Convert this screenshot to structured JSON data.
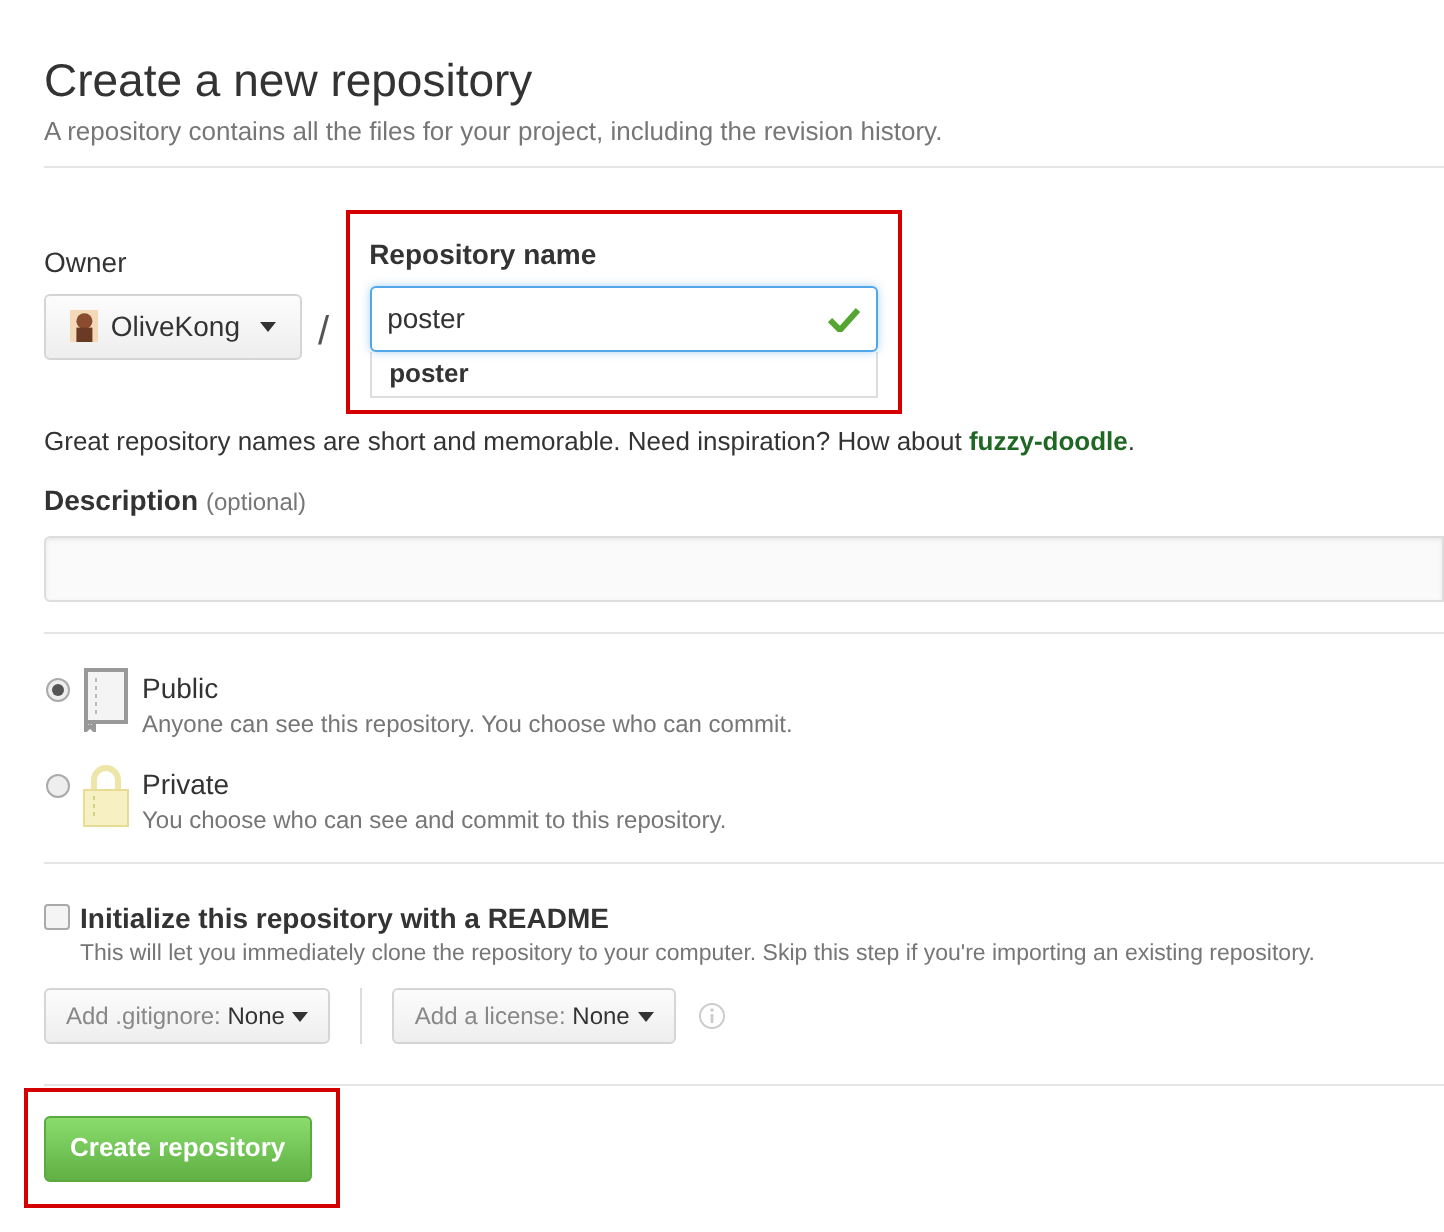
{
  "header": {
    "title": "Create a new repository",
    "subtitle": "A repository contains all the files for your project, including the revision history."
  },
  "owner": {
    "label": "Owner",
    "value": "OliveKong"
  },
  "separator": "/",
  "repository_name": {
    "label": "Repository name",
    "value": "poster",
    "valid": true,
    "highlighted": true,
    "suggestions": [
      "poster"
    ]
  },
  "hint": {
    "text": "Great repository names are short and memorable. Need inspiration? How about ",
    "link": "fuzzy-doodle",
    "end": "."
  },
  "description": {
    "label": "Description",
    "optional": "(optional)"
  },
  "visibility": [
    {
      "kind": "book",
      "title": "Public",
      "text": "Anyone can see this repository. You choose who can commit.",
      "selected": true
    },
    {
      "kind": "lock",
      "title": "Private",
      "text": "You choose who can see and commit to this repository.",
      "selected": false
    }
  ],
  "readme": {
    "label": "Initialize this repository with a README",
    "text": "This will let you immediately clone the repository to your computer. Skip this step if you're importing an existing repository.",
    "checked": false
  },
  "gitignore": {
    "label": "Add .gitignore:",
    "value": "None"
  },
  "license": {
    "label": "Add a license:",
    "value": "None"
  },
  "submit": {
    "label": "Create repository",
    "highlighted": true
  }
}
